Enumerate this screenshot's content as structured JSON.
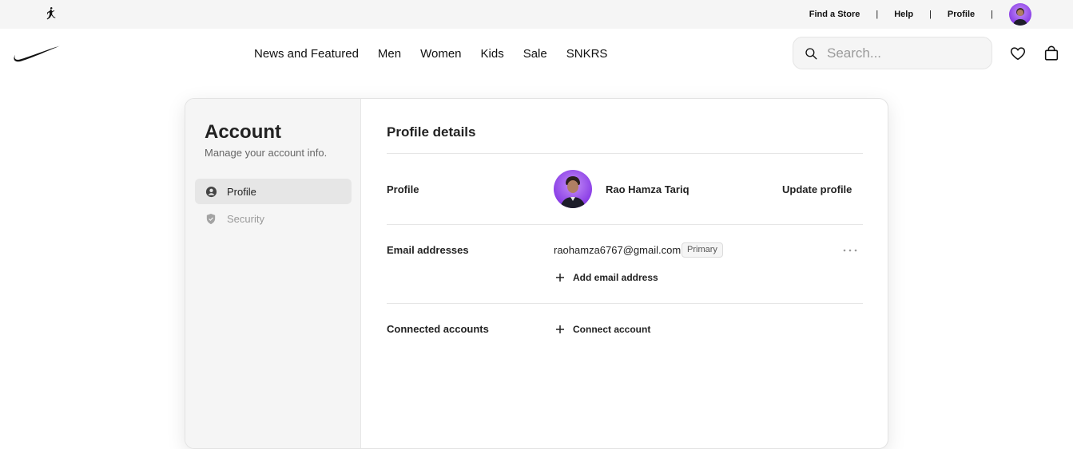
{
  "utility_bar": {
    "links": [
      "Find a Store",
      "Help",
      "Profile"
    ],
    "separator": "|"
  },
  "nav": {
    "items": [
      "News and Featured",
      "Men",
      "Women",
      "Kids",
      "Sale",
      "SNKRS"
    ],
    "search_placeholder": "Search..."
  },
  "sidebar": {
    "title": "Account",
    "subtitle": "Manage your account info.",
    "items": [
      {
        "label": "Profile",
        "icon": "user-circle-icon",
        "active": true
      },
      {
        "label": "Security",
        "icon": "shield-icon",
        "active": false
      }
    ]
  },
  "main": {
    "title": "Profile details",
    "profile": {
      "label": "Profile",
      "name": "Rao Hamza Tariq",
      "action": "Update profile"
    },
    "email": {
      "label": "Email addresses",
      "address": "raohamza6767@gmail.com",
      "badge": "Primary",
      "add_label": "Add email address"
    },
    "connected": {
      "label": "Connected accounts",
      "add_label": "Connect account"
    }
  },
  "colors": {
    "avatar_purple": "#8a3ee6",
    "utility_bg": "#f5f5f5",
    "sidebar_bg": "#f5f5f5"
  }
}
